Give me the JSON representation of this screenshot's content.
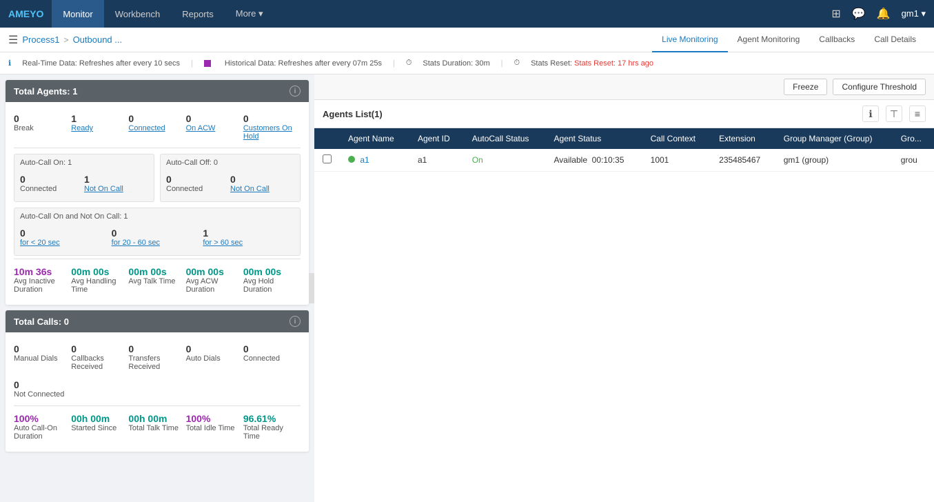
{
  "app": {
    "logo": "AMEYO",
    "nav": {
      "items": [
        {
          "label": "Monitor",
          "active": true
        },
        {
          "label": "Workbench",
          "active": false
        },
        {
          "label": "Reports",
          "active": false
        },
        {
          "label": "More ▾",
          "active": false
        }
      ]
    },
    "nav_right": {
      "grid_icon": "⊞",
      "chat_icon": "💬",
      "bell_icon": "🔔",
      "user": "gm1 ▾"
    }
  },
  "breadcrumb": {
    "menu_icon": "☰",
    "process": "Process1",
    "separator": ">",
    "current": "Outbound ..."
  },
  "tabs": [
    {
      "label": "Live Monitoring",
      "active": true
    },
    {
      "label": "Agent Monitoring",
      "active": false
    },
    {
      "label": "Callbacks",
      "active": false
    },
    {
      "label": "Call Details",
      "active": false
    }
  ],
  "info_bar": {
    "realtime_icon": "ℹ",
    "realtime_text": "Real-Time Data: Refreshes after every 10 secs",
    "sep1": "|",
    "historical_label": "Historical Data: Refreshes after every 07m 25s",
    "sep2": "|",
    "stats_duration_icon": "⏱",
    "stats_duration": "Stats Duration: 30m",
    "sep3": "|",
    "stats_reset_icon": "⏱",
    "stats_reset": "Stats Reset: 17 hrs ago"
  },
  "total_agents_card": {
    "title": "Total Agents: 1",
    "stats": [
      {
        "value": "0",
        "label": "Break",
        "linked": false
      },
      {
        "value": "1",
        "label": "Ready",
        "linked": true
      },
      {
        "value": "0",
        "label": "Connected",
        "linked": true
      },
      {
        "value": "0",
        "label": "On ACW",
        "linked": true
      },
      {
        "value": "0",
        "label": "Customers On Hold",
        "linked": true
      }
    ],
    "autocall_on": {
      "title": "Auto-Call On: 1",
      "stats": [
        {
          "value": "0",
          "label": "Connected",
          "linked": false
        },
        {
          "value": "1",
          "label": "Not On Call",
          "linked": true
        }
      ]
    },
    "autocall_off": {
      "title": "Auto-Call Off: 0",
      "stats": [
        {
          "value": "0",
          "label": "Connected",
          "linked": false
        },
        {
          "value": "0",
          "label": "Not On Call",
          "linked": true
        }
      ]
    },
    "not_on_call": {
      "title": "Auto-Call On and Not On Call: 1",
      "stats": [
        {
          "value": "0",
          "label": "for < 20 sec",
          "linked": true
        },
        {
          "value": "0",
          "label": "for 20 - 60 sec",
          "linked": true
        },
        {
          "value": "1",
          "label": "for > 60 sec",
          "linked": true
        }
      ]
    },
    "avg_stats": [
      {
        "value": "10m 36s",
        "label": "Avg Inactive Duration",
        "color": "purple"
      },
      {
        "value": "00m 00s",
        "label": "Avg Handling Time",
        "color": "teal"
      },
      {
        "value": "00m 00s",
        "label": "Avg Talk Time",
        "color": "teal"
      },
      {
        "value": "00m 00s",
        "label": "Avg ACW Duration",
        "color": "teal"
      },
      {
        "value": "00m 00s",
        "label": "Avg Hold Duration",
        "color": "teal"
      }
    ]
  },
  "total_calls_card": {
    "title": "Total Calls: 0",
    "stats_row1": [
      {
        "value": "0",
        "label": "Manual Dials",
        "linked": false
      },
      {
        "value": "0",
        "label": "Callbacks Received",
        "linked": false
      },
      {
        "value": "0",
        "label": "Transfers Received",
        "linked": false
      },
      {
        "value": "0",
        "label": "Auto Dials",
        "linked": false
      },
      {
        "value": "0",
        "label": "Connected",
        "linked": false
      }
    ],
    "stats_row2": [
      {
        "value": "0",
        "label": "Not Connected",
        "linked": false
      }
    ],
    "stats_row3": [
      {
        "value": "100%",
        "label": "Auto Call-On Duration",
        "color": "purple"
      },
      {
        "value": "00h 00m",
        "label": "Started Since",
        "color": "teal"
      },
      {
        "value": "00h 00m",
        "label": "Total Talk Time",
        "color": "teal"
      },
      {
        "value": "100%",
        "label": "Total Idle Time",
        "color": "purple"
      },
      {
        "value": "96.61%",
        "label": "Total Ready Time",
        "color": "teal"
      }
    ]
  },
  "right_panel": {
    "agents_list_title": "Agents List(1)",
    "freeze_btn": "Freeze",
    "configure_threshold_btn": "Configure Threshold",
    "table": {
      "columns": [
        "",
        "Agent Name",
        "Agent ID",
        "AutoCall Status",
        "Agent Status",
        "Call Context",
        "Extension",
        "Group Manager (Group)",
        "Gro..."
      ],
      "rows": [
        {
          "checkbox": false,
          "status_dot": "green",
          "agent_name": "a1",
          "agent_id": "a1",
          "autocall_status": "On",
          "agent_status": "Available",
          "call_context": "00:10:35",
          "extension": "1001",
          "group_manager": "235485467",
          "group": "gm1 (group)",
          "gro": "grou"
        }
      ]
    },
    "collapse_icon": "‹"
  }
}
